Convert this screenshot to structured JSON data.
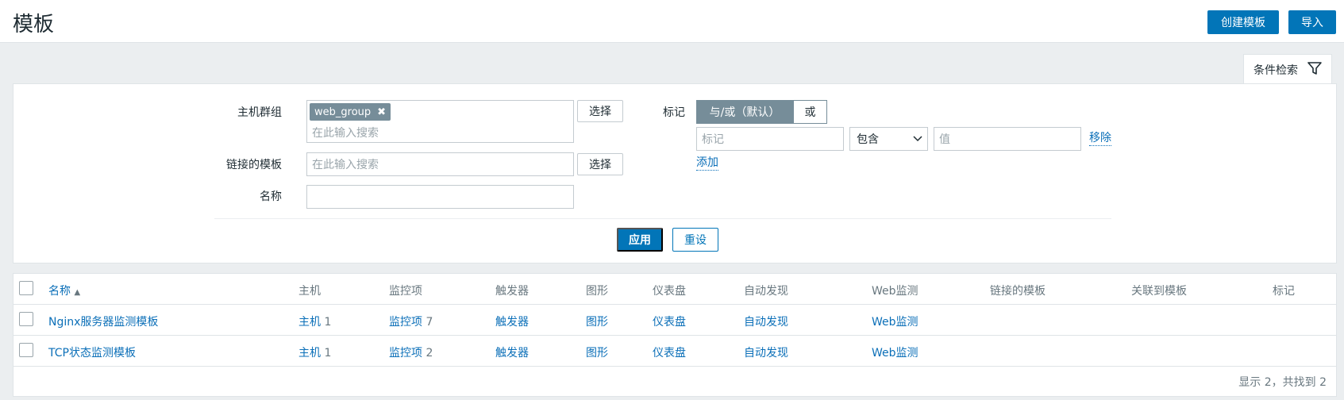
{
  "header": {
    "title": "模板",
    "create_button": "创建模板",
    "import_button": "导入"
  },
  "filter": {
    "tab_label": "条件检索",
    "host_group_label": "主机群组",
    "host_group_chip": "web_group",
    "host_group_placeholder": "在此输入搜索",
    "linked_template_label": "链接的模板",
    "linked_template_placeholder": "在此输入搜索",
    "name_label": "名称",
    "name_value": "",
    "select_button": "选择",
    "tags_label": "标记",
    "tag_mode_and": "与/或（默认）",
    "tag_mode_or": "或",
    "tag_placeholder": "标记",
    "tag_operator": "包含",
    "value_placeholder": "值",
    "remove_link": "移除",
    "add_link": "添加",
    "apply_button": "应用",
    "reset_button": "重设"
  },
  "table": {
    "columns": [
      "名称",
      "主机",
      "监控项",
      "触发器",
      "图形",
      "仪表盘",
      "自动发现",
      "Web监测",
      "链接的模板",
      "关联到模板",
      "标记"
    ],
    "sort_arrow": "▲",
    "rows": [
      {
        "name": "Nginx服务器监测模板",
        "hosts_label": "主机",
        "hosts_count": "1",
        "items_label": "监控项",
        "items_count": "7",
        "triggers": "触发器",
        "graphs": "图形",
        "dashboards": "仪表盘",
        "discovery": "自动发现",
        "web": "Web监测"
      },
      {
        "name": "TCP状态监测模板",
        "hosts_label": "主机",
        "hosts_count": "1",
        "items_label": "监控项",
        "items_count": "2",
        "triggers": "触发器",
        "graphs": "图形",
        "dashboards": "仪表盘",
        "discovery": "自动发现",
        "web": "Web监测"
      }
    ],
    "footer": "显示 2，共找到 2"
  },
  "colors": {
    "primary": "#0275b8",
    "chip": "#768d99",
    "link": "#0b6fb8",
    "background": "#ebeef0"
  }
}
